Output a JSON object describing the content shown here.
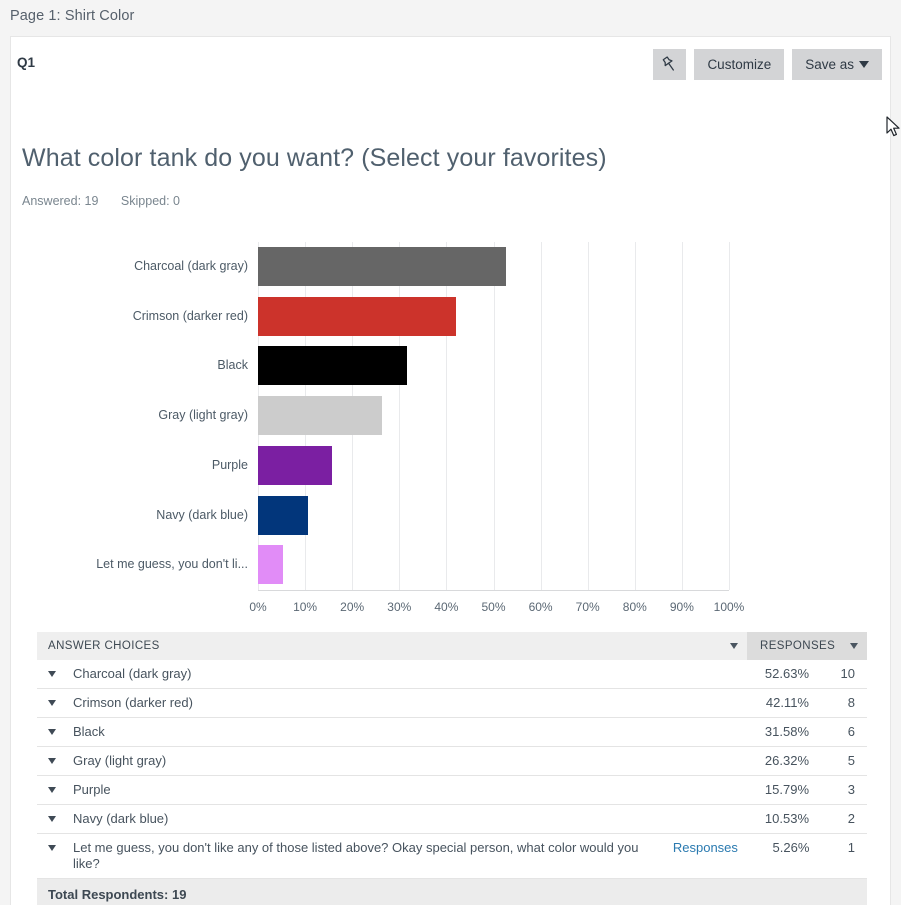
{
  "breadcrumb": "Page 1: Shirt Color",
  "card": {
    "question_number": "Q1",
    "title": "What color tank do you want? (Select your favorites)",
    "answered_label": "Answered: 19",
    "skipped_label": "Skipped: 0"
  },
  "toolbar": {
    "pin_icon": "pushpin-icon",
    "customize_label": "Customize",
    "save_as_label": "Save as"
  },
  "chart_data": {
    "type": "bar",
    "orientation": "horizontal",
    "title": "What color tank do you want? (Select your favorites)",
    "xlabel": "",
    "ylabel": "",
    "xlim": [
      0,
      100
    ],
    "xticks": [
      "0%",
      "10%",
      "20%",
      "30%",
      "40%",
      "50%",
      "60%",
      "70%",
      "80%",
      "90%",
      "100%"
    ],
    "grid": true,
    "legend": "none",
    "categories": [
      "Charcoal (dark gray)",
      "Crimson (darker red)",
      "Black",
      "Gray (light gray)",
      "Purple",
      "Navy (dark blue)",
      "Let me guess, you don't li..."
    ],
    "values": [
      52.63,
      42.11,
      31.58,
      26.32,
      15.79,
      10.53,
      5.26
    ],
    "counts": [
      10,
      8,
      6,
      5,
      3,
      2,
      1
    ],
    "colors": [
      "#666666",
      "#cc332b",
      "#000000",
      "#cccccc",
      "#7b1fa2",
      "#02367b",
      "#e18cf7"
    ]
  },
  "table": {
    "header_choices": "ANSWER CHOICES",
    "header_responses": "RESPONSES",
    "responses_link_label": "Responses",
    "rows": [
      {
        "choice": "Charcoal (dark gray)",
        "percent": "52.63%",
        "count": "10",
        "has_link": false
      },
      {
        "choice": "Crimson (darker red)",
        "percent": "42.11%",
        "count": "8",
        "has_link": false
      },
      {
        "choice": "Black",
        "percent": "31.58%",
        "count": "6",
        "has_link": false
      },
      {
        "choice": "Gray (light gray)",
        "percent": "26.32%",
        "count": "5",
        "has_link": false
      },
      {
        "choice": "Purple",
        "percent": "15.79%",
        "count": "3",
        "has_link": false
      },
      {
        "choice": "Navy (dark blue)",
        "percent": "10.53%",
        "count": "2",
        "has_link": false
      },
      {
        "choice": "Let me guess, you don't like any of those listed above? Okay special person, what color would you like?",
        "percent": "5.26%",
        "count": "1",
        "has_link": true
      }
    ],
    "total_label": "Total Respondents: 19"
  }
}
